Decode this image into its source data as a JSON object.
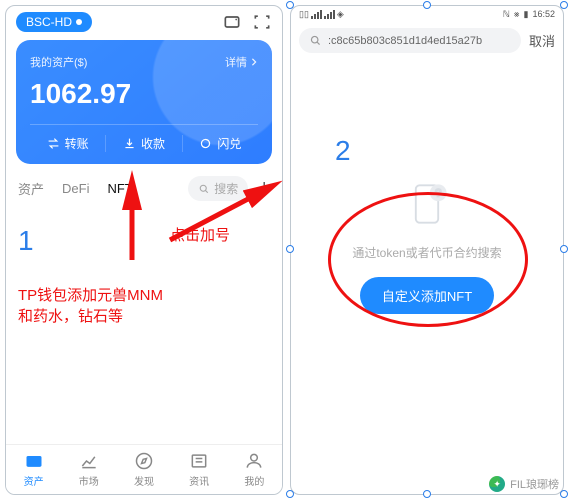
{
  "phone1": {
    "chain_label": "BSC-HD",
    "card": {
      "title": "我的资产($)",
      "detail_label": "详情",
      "amount": "1062.97",
      "actions": {
        "transfer": "转账",
        "receive": "收款",
        "swap": "闪兑"
      }
    },
    "tabs": {
      "assets": "资产",
      "defi": "DeFi",
      "nft": "NFT"
    },
    "search_placeholder": "搜索",
    "nav": {
      "assets": "资产",
      "market": "市场",
      "discover": "发现",
      "news": "资讯",
      "mine": "我的"
    }
  },
  "phone2": {
    "time": "16:52",
    "search_value": ":c8c65b803c851d1d4ed15a27b",
    "cancel": "取消",
    "empty_text": "通过token或者代币合约搜索",
    "custom_btn": "自定义添加NFT"
  },
  "annotations": {
    "num1": "1",
    "num2": "2",
    "plus_hint": "点击加号",
    "tp_line1": "TP钱包添加元兽MNM",
    "tp_line2": "和药水，钻石等"
  },
  "watermark": "FIL琅琊榜"
}
